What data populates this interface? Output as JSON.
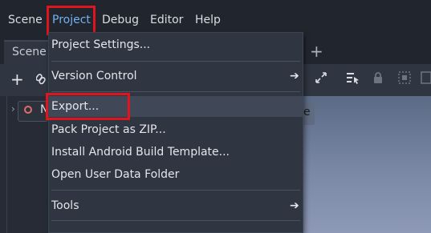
{
  "menubar": {
    "items": [
      "Scene",
      "Project",
      "Debug",
      "Editor",
      "Help"
    ],
    "active_item": "Project"
  },
  "scene_dock": {
    "tab_label": "Scene",
    "tree_node_label": "N"
  },
  "project_menu": {
    "items": [
      {
        "label": "Project Settings..."
      },
      {
        "label": "Version Control",
        "submenu_icon": "chevron-right-icon"
      },
      {
        "label": "Export..."
      },
      {
        "label": "Pack Project as ZIP..."
      },
      {
        "label": "Install Android Build Template..."
      },
      {
        "label": "Open User Data Folder"
      },
      {
        "label": "Tools",
        "submenu_icon": "chevron-right-icon"
      }
    ],
    "highlighted_item": "Export..."
  },
  "viewport": {
    "partial_label": "e"
  },
  "icons": {
    "add": "add-icon",
    "link": "link-icon",
    "new_tab": "plus-icon",
    "toolbar": [
      "expand-icon",
      "select-list-icon",
      "lock-icon",
      "group-icon",
      "grid-icon"
    ]
  },
  "colors": {
    "menubar_bg": "#21262e",
    "menu_bg": "#2f3541",
    "active_menu_text": "#73b2f0",
    "annotation_red": "#e0141c",
    "hover_bg": "#404756"
  }
}
